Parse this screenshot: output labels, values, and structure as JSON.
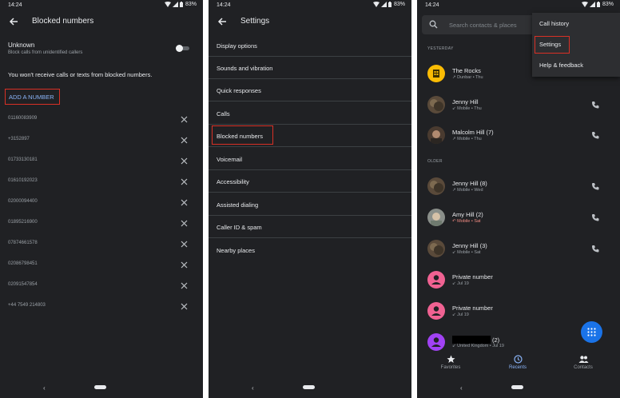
{
  "status_bar": {
    "time": "14:24",
    "battery": "83%"
  },
  "blocked_screen": {
    "title": "Blocked numbers",
    "unknown": {
      "title": "Unknown",
      "subtitle": "Block calls from unidentified callers",
      "enabled": false
    },
    "notice": "You won't receive calls or texts from blocked numbers.",
    "add_button": "ADD A NUMBER",
    "numbers": [
      "01160083909",
      "+3152897",
      "01733130181",
      "01610192023",
      "02000094400",
      "01895216900",
      "07874661578",
      "02086798451",
      "02091547854",
      "+44 7549 214803"
    ]
  },
  "settings_screen": {
    "title": "Settings",
    "items": [
      "Display options",
      "Sounds and vibration",
      "Quick responses",
      "Calls",
      "Blocked numbers",
      "Voicemail",
      "Accessibility",
      "Assisted dialing",
      "Caller ID & spam",
      "Nearby places"
    ]
  },
  "dialer_screen": {
    "search_placeholder": "Search contacts & places",
    "sections": {
      "yesterday": "YESTERDAY",
      "older": "OLDER"
    },
    "calls": [
      {
        "name": "The Rocks",
        "meta": "↗ Dunbar • Thu",
        "avatar": "business-icon",
        "missed": false
      },
      {
        "name": "Jenny Hill",
        "meta": "↙ Mobile • Thu",
        "avatar": "photo",
        "missed": false
      },
      {
        "name": "Malcolm Hill  (7)",
        "meta": "↗ Mobile • Thu",
        "avatar": "photo",
        "missed": false
      },
      {
        "name": "Jenny Hill  (8)",
        "meta": "↗ Mobile • Wed",
        "avatar": "photo",
        "missed": false
      },
      {
        "name": "Amy Hill  (2)",
        "meta": "↶ Mobile • Sat",
        "avatar": "photo",
        "missed": true
      },
      {
        "name": "Jenny Hill  (3)",
        "meta": "↙ Mobile • Sat",
        "avatar": "photo",
        "missed": false
      },
      {
        "name": "Private number",
        "meta": "↙ Jul 19",
        "avatar": "person-icon",
        "missed": false
      },
      {
        "name": "Private number",
        "meta": "↙ Jul 19",
        "avatar": "person-icon",
        "missed": false
      },
      {
        "name": "(2)",
        "meta": "↙ United Kingdom • Jul 19",
        "avatar": "person-icon",
        "missed": false
      }
    ],
    "menu": [
      "Call history",
      "Settings",
      "Help & feedback"
    ],
    "nav": [
      "Favorites",
      "Recents",
      "Contacts"
    ],
    "active_nav": "Recents"
  },
  "colors": {
    "background": "#202124",
    "accent": "#8ab4f8",
    "highlight": "#d93025",
    "fab": "#1a73e8",
    "private_avatar": "#f06292",
    "unknown_avatar": "#a142f4",
    "business_avatar": "#fbbc04"
  }
}
